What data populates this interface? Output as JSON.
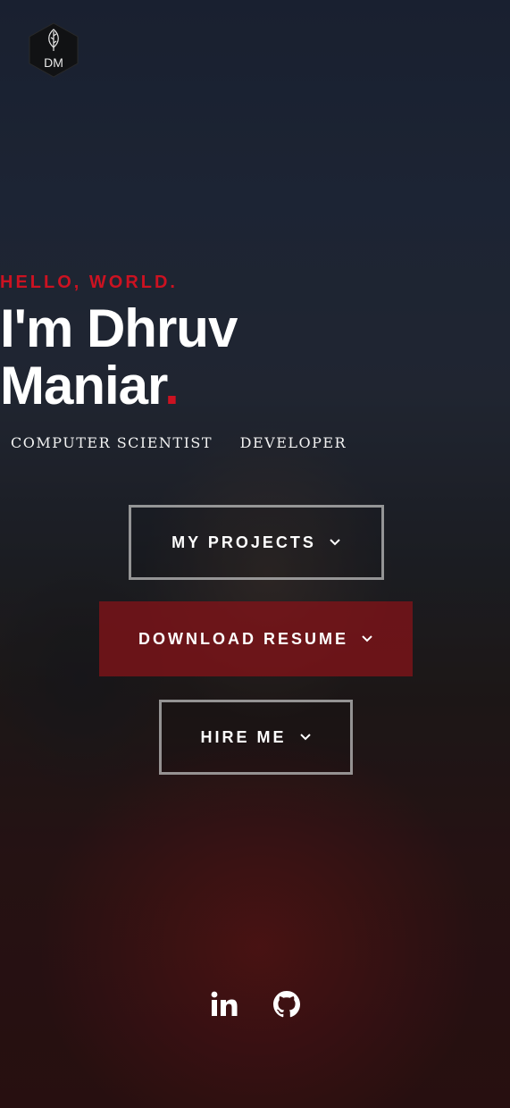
{
  "logo": {
    "initials": "DM",
    "icon": "leaf-icon"
  },
  "hero": {
    "greeting": "HELLO, WORLD.",
    "name_line1": "I'm Dhruv",
    "name_line2": "Maniar",
    "name_dot": ".",
    "roles": [
      "COMPUTER SCIENTIST",
      "DEVELOPER"
    ]
  },
  "buttons": {
    "projects": "MY PROJECTS",
    "resume": "DOWNLOAD RESUME",
    "hire": "HIRE ME"
  },
  "social": [
    "linkedin-icon",
    "github-icon"
  ],
  "colors": {
    "accent": "#cc1221",
    "text": "#ffffff"
  }
}
